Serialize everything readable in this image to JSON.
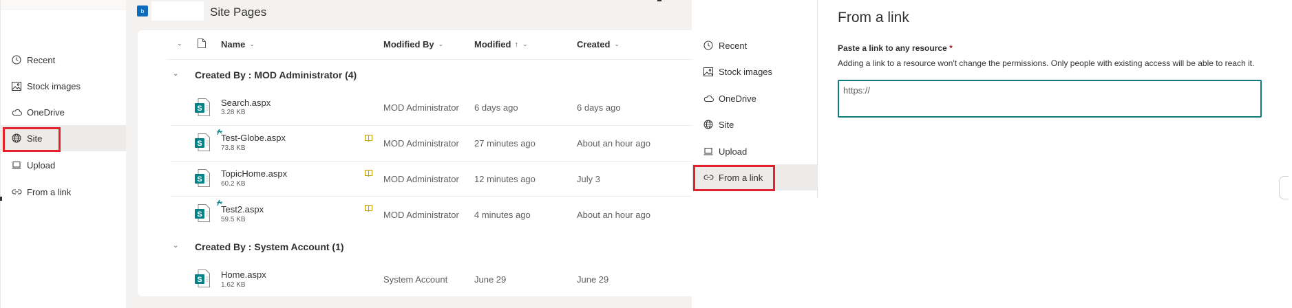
{
  "left_nav": {
    "items": [
      {
        "label": "Recent",
        "icon": "clock-icon"
      },
      {
        "label": "Stock images",
        "icon": "image-icon"
      },
      {
        "label": "OneDrive",
        "icon": "cloud-icon"
      },
      {
        "label": "Site",
        "icon": "globe-icon"
      },
      {
        "label": "Upload",
        "icon": "laptop-icon"
      },
      {
        "label": "From a link",
        "icon": "link-icon"
      }
    ],
    "selected": "Site"
  },
  "site": {
    "logo_text": "b",
    "title": "Site Pages"
  },
  "columns": {
    "name": "Name",
    "modified_by": "Modified By",
    "modified": "Modified",
    "created": "Created",
    "sort_arrow": "↑"
  },
  "groups": [
    {
      "header": "Created By : MOD Administrator (4)",
      "rows": [
        {
          "name": "Search.aspx",
          "size": "3.28 KB",
          "modified_by": "MOD Administrator",
          "modified": "6 days ago",
          "created": "6 days ago",
          "new": false,
          "checked_out": false
        },
        {
          "name": "Test-Globe.aspx",
          "size": "73.8 KB",
          "modified_by": "MOD Administrator",
          "modified": "27 minutes ago",
          "created": "About an hour ago",
          "new": true,
          "checked_out": true
        },
        {
          "name": "TopicHome.aspx",
          "size": "60.2 KB",
          "modified_by": "MOD Administrator",
          "modified": "12 minutes ago",
          "created": "July 3",
          "new": false,
          "checked_out": true
        },
        {
          "name": "Test2.aspx",
          "size": "59.5 KB",
          "modified_by": "MOD Administrator",
          "modified": "4 minutes ago",
          "created": "About an hour ago",
          "new": true,
          "checked_out": true
        }
      ]
    },
    {
      "header": "Created By : System Account (1)",
      "rows": [
        {
          "name": "Home.aspx",
          "size": "1.62 KB",
          "modified_by": "System Account",
          "modified": "June 29",
          "created": "June 29",
          "new": false,
          "checked_out": false
        }
      ]
    }
  ],
  "right_nav": {
    "items": [
      {
        "label": "Recent",
        "icon": "clock-icon"
      },
      {
        "label": "Stock images",
        "icon": "image-icon"
      },
      {
        "label": "OneDrive",
        "icon": "cloud-icon"
      },
      {
        "label": "Site",
        "icon": "globe-icon"
      },
      {
        "label": "Upload",
        "icon": "laptop-icon"
      },
      {
        "label": "From a link",
        "icon": "link-icon"
      }
    ],
    "selected": "From a link"
  },
  "link_panel": {
    "title": "From a link",
    "field_label": "Paste a link to any resource",
    "required_mark": "*",
    "help_text": "Adding a link to a resource won't change the permissions. Only people with existing access will be able to reach it.",
    "placeholder": "https://"
  },
  "colors": {
    "highlight_box": "#e3212d",
    "input_border": "#0f7b7b",
    "selected_bg": "#edebe9",
    "sharepoint_icon": "#038387"
  }
}
